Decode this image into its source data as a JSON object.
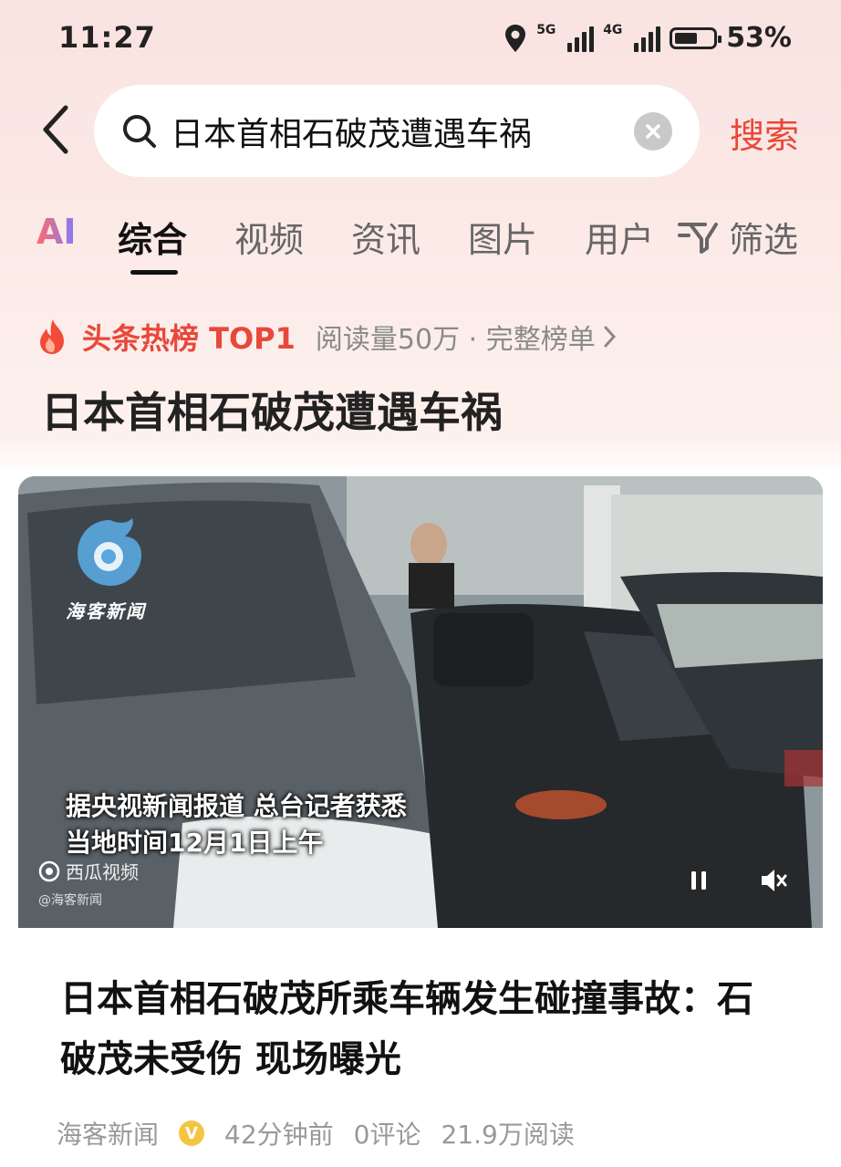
{
  "status_bar": {
    "time": "11:27",
    "network1": "5G",
    "network2": "4G",
    "battery": "53%",
    "battery_level": 0.53
  },
  "search": {
    "query": "日本首相石破茂遭遇车祸",
    "button_label": "搜索"
  },
  "tabs": [
    {
      "label": "AI"
    },
    {
      "label": "综合",
      "active": true
    },
    {
      "label": "视频"
    },
    {
      "label": "资讯"
    },
    {
      "label": "图片"
    },
    {
      "label": "用户"
    }
  ],
  "filter_label": "筛选",
  "hot_list": {
    "title": "头条热榜 TOP1",
    "meta": "阅读量50万 · 完整榜单"
  },
  "headline": "日本首相石破茂遭遇车祸",
  "video_card": {
    "watermark_brand": "海客新闻",
    "caption_line1": "据央视新闻报道 总台记者获悉",
    "caption_line2": "当地时间12月1日上午",
    "source_logo": "西瓜视频",
    "source_small": "@海客新闻",
    "title": "日本首相石破茂所乘车辆发生碰撞事故：石破茂未受伤 现场曝光",
    "author": "海客新闻",
    "author_badge": "V",
    "time_ago": "42分钟前",
    "comments": "0评论",
    "reads": "21.9万阅读"
  },
  "colors": {
    "accent": "#e8483a",
    "hot": "#e8483a"
  }
}
